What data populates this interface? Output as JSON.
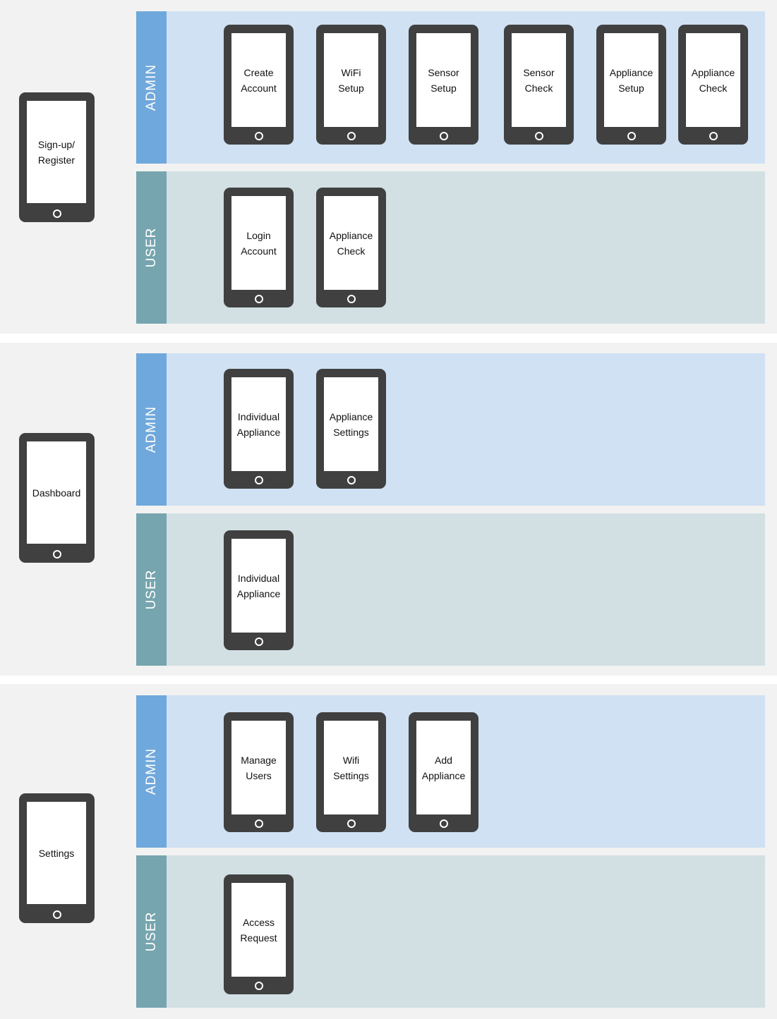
{
  "sections": [
    {
      "main_screen": "Sign-up/\nRegister",
      "admin": {
        "label": "ADMIN",
        "screens": [
          "Create\nAccount",
          "WiFi\nSetup",
          "Sensor\nSetup",
          "Sensor\nCheck",
          "Appliance\nSetup",
          "Appliance\nCheck"
        ]
      },
      "user": {
        "label": "USER",
        "screens": [
          "Login\nAccount",
          "Appliance\nCheck"
        ]
      }
    },
    {
      "main_screen": "Dashboard",
      "admin": {
        "label": "ADMIN",
        "screens": [
          "Individual\nAppliance",
          "Appliance\nSettings"
        ]
      },
      "user": {
        "label": "USER",
        "screens": [
          "Individual\nAppliance"
        ]
      }
    },
    {
      "main_screen": "Settings",
      "admin": {
        "label": "ADMIN",
        "screens": [
          "Manage\nUsers",
          "Wifi\nSettings",
          "Add\nAppliance"
        ]
      },
      "user": {
        "label": "USER",
        "screens": [
          "Access\nRequest"
        ]
      }
    }
  ]
}
